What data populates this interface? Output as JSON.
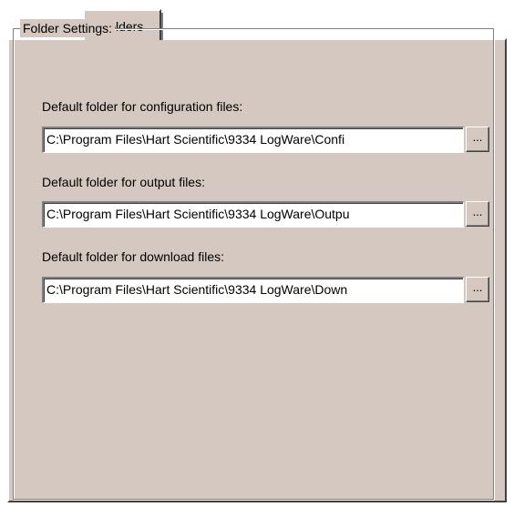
{
  "tabs": [
    {
      "label": "Folders"
    }
  ],
  "group": {
    "title": "Folder Settings:"
  },
  "fields": {
    "config": {
      "label": "Default folder for configuration files:",
      "value": "C:\\Program Files\\Hart Scientific\\9334 LogWare\\Confi",
      "browse_label": "..."
    },
    "output": {
      "label": "Default folder for output files:",
      "value": "C:\\Program Files\\Hart Scientific\\9334 LogWare\\Outpu",
      "browse_label": "..."
    },
    "download": {
      "label": "Default folder for download files:",
      "value": "C:\\Program Files\\Hart Scientific\\9334 LogWare\\Down",
      "browse_label": "..."
    }
  },
  "colors": {
    "dialog_face": "#d4c8c0",
    "highlight": "#ffffff",
    "shadow": "#808080",
    "dark_shadow": "#404040"
  }
}
